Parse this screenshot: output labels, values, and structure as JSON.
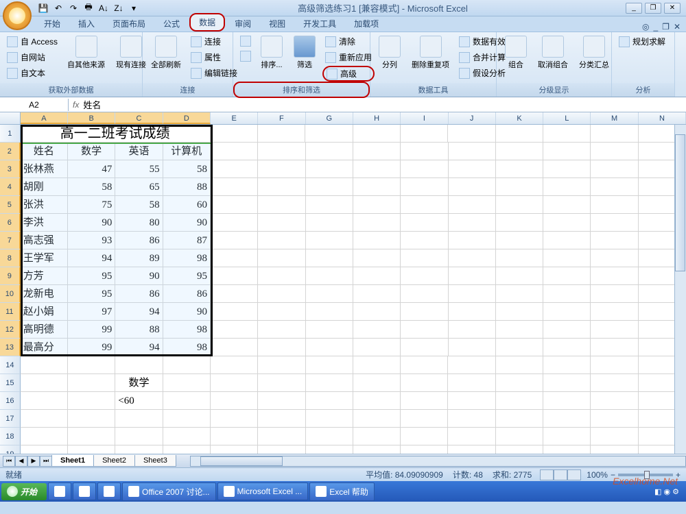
{
  "title": "高级筛选练习1 [兼容模式] - Microsoft Excel",
  "qat_icons": [
    "save",
    "undo",
    "redo",
    "print",
    "sort-asc",
    "sort-desc",
    "group",
    "ungroup"
  ],
  "tabs": [
    "开始",
    "插入",
    "页面布局",
    "公式",
    "数据",
    "审阅",
    "视图",
    "开发工具",
    "加载项"
  ],
  "active_tab": 4,
  "ribbon_groups": {
    "external": {
      "label": "获取外部数据",
      "access": "自 Access",
      "web": "自网站",
      "text": "自文本",
      "other": "自其他来源",
      "existing": "现有连接"
    },
    "connections": {
      "label": "连接",
      "refresh": "全部刷新",
      "conn": "连接",
      "props": "属性",
      "editlinks": "编辑链接"
    },
    "sortfilter": {
      "label": "排序和筛选",
      "sort": "排序...",
      "filter": "筛选",
      "clear": "清除",
      "reapply": "重新应用",
      "advanced": "高级"
    },
    "datatools": {
      "label": "数据工具",
      "texttocols": "分列",
      "removedup": "删除重复项",
      "validation": "数据有效性",
      "consolidate": "合并计算",
      "whatif": "假设分析"
    },
    "outline": {
      "label": "分级显示",
      "group": "组合",
      "ungroup": "取消组合",
      "subtotal": "分类汇总"
    },
    "analysis": {
      "label": "分析",
      "solver": "规划求解"
    }
  },
  "name_box": "A2",
  "formula_value": "姓名",
  "columns": [
    "A",
    "B",
    "C",
    "D",
    "E",
    "F",
    "G",
    "H",
    "I",
    "J",
    "K",
    "L",
    "M",
    "N"
  ],
  "table_title": "高一二班考试成绩",
  "headers": [
    "姓名",
    "数学",
    "英语",
    "计算机"
  ],
  "rows": [
    [
      "张林燕",
      "47",
      "55",
      "58"
    ],
    [
      "胡刚",
      "58",
      "65",
      "88"
    ],
    [
      "张洪",
      "75",
      "58",
      "60"
    ],
    [
      "李洪",
      "90",
      "80",
      "90"
    ],
    [
      "高志强",
      "93",
      "86",
      "87"
    ],
    [
      "王学军",
      "94",
      "89",
      "98"
    ],
    [
      "方芳",
      "95",
      "90",
      "95"
    ],
    [
      "龙新电",
      "95",
      "86",
      "86"
    ],
    [
      "赵小娟",
      "97",
      "94",
      "90"
    ],
    [
      "高明德",
      "99",
      "88",
      "98"
    ],
    [
      "最高分",
      "99",
      "94",
      "98"
    ]
  ],
  "criteria": {
    "field": "数学",
    "cond": "<60"
  },
  "sheets": [
    "Sheet1",
    "Sheet2",
    "Sheet3"
  ],
  "status": {
    "ready": "就绪",
    "avg_label": "平均值:",
    "avg": "84.09090909",
    "count_label": "计数:",
    "count": "48",
    "sum_label": "求和:",
    "sum": "2775",
    "zoom": "100%"
  },
  "taskbar": {
    "start": "开始",
    "items": [
      "Office 2007 讨论...",
      "Microsoft Excel ...",
      "Excel 帮助"
    ]
  },
  "watermark": "Excelhome.Net"
}
